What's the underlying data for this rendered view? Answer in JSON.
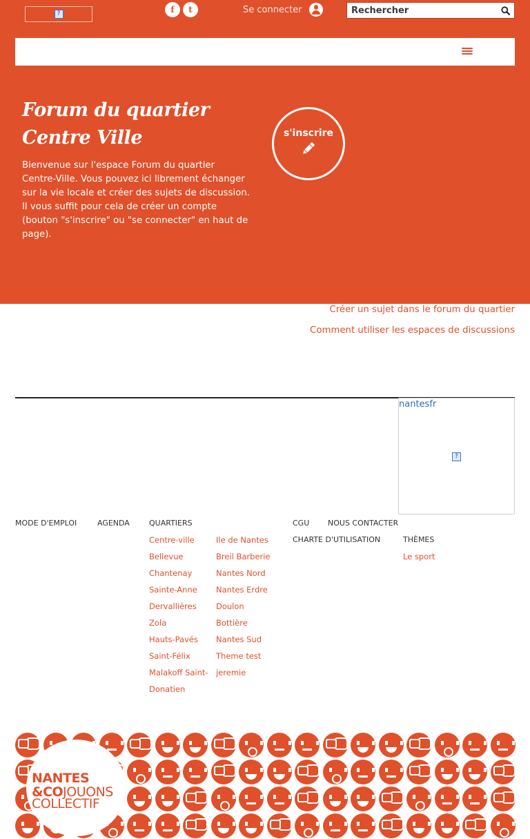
{
  "header": {
    "login_label": "Se connecter",
    "search_placeholder": "Rechercher",
    "social": {
      "facebook": "f",
      "twitter": "t"
    },
    "accent_color": "#e0502b"
  },
  "hero": {
    "title": "Forum du quartier Centre Ville",
    "description": "Bienvenue sur l'espace Forum du quartier Centre-Ville. Vous pouvez ici librement échanger sur la vie locale et créer des sujets de discussion. Il vous suffit pour cela de créer un compte (bouton \"s'inscrire\" ou \"se connecter\" en haut de page).",
    "subscribe_label": "s'inscrire"
  },
  "links": {
    "create_topic": "Créer un sujet dans le forum du quartier",
    "how_to": "Comment utiliser les espaces de discussions"
  },
  "sidebar_ad": {
    "label": "nantesfr"
  },
  "footer": {
    "mode_emploi": "MODE D'EMPLOI",
    "agenda": "AGENDA",
    "quartiers": "QUARTIERS",
    "cgu": "CGU",
    "contact": "NOUS CONTACTER",
    "charte": "CHARTE D'UTILISATION",
    "themes": "THÈMES",
    "quartiers_col1": [
      "Centre-ville",
      "Bellevue",
      "Chantenay",
      "Sainte-Anne",
      "Dervallières",
      "Zola",
      "Hauts-Pavés",
      "Saint-Félix",
      "Malakoff Saint-",
      "Donatien"
    ],
    "quartiers_col2": [
      "Ile de Nantes",
      "Breil Barberie",
      "Nantes Nord",
      "Nantes Erdre",
      "Doulon",
      "Bottière",
      "Nantes Sud",
      "Theme test",
      "jeremie"
    ],
    "themes_list": [
      "Le sport"
    ]
  },
  "brand": {
    "line1": "NANTES",
    "line2_bold": "&CO",
    "line2_rest": "JOUONS",
    "line3": "COLLECTIF"
  },
  "icons": [
    "facebook-icon",
    "twitter-icon",
    "user-icon",
    "search-icon",
    "hamburger-icon",
    "pencil-icon",
    "broken-image-icon"
  ]
}
